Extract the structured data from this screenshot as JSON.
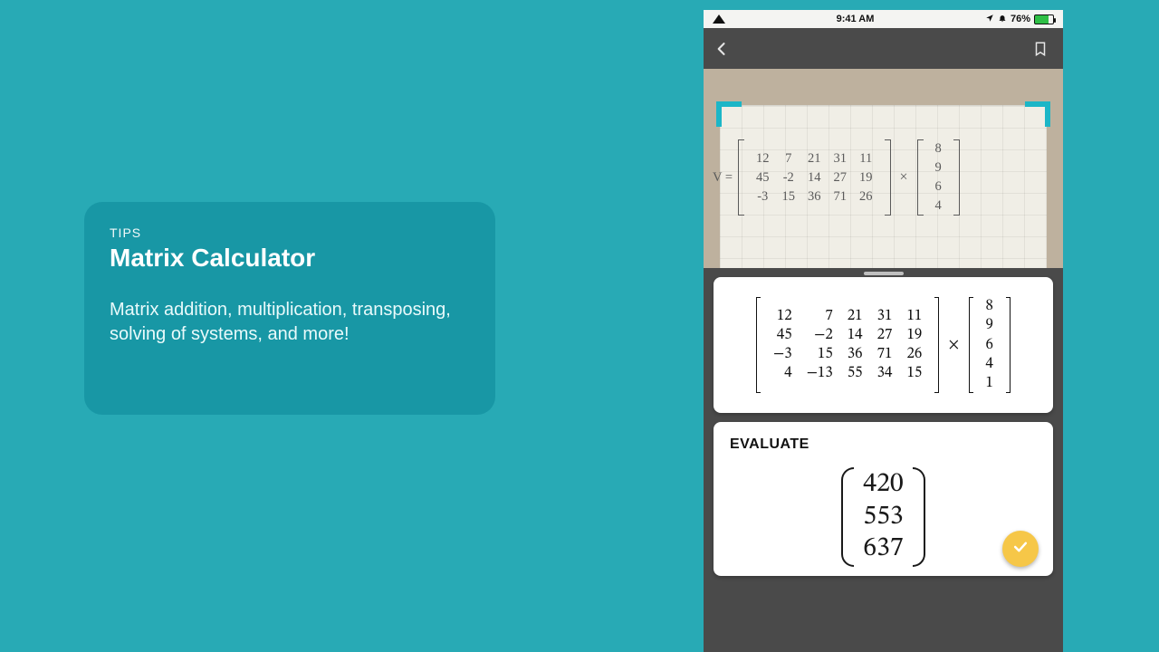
{
  "promo": {
    "eyebrow": "TIPS",
    "title": "Matrix Calculator",
    "desc": "Matrix addition, multiplication, transposing, solving of systems, and more!"
  },
  "statusbar": {
    "time": "9:41 AM",
    "battery_pct": "76%"
  },
  "handwritten": {
    "var_label": "V =",
    "matrix_a": [
      [
        "12",
        "7",
        "21",
        "31",
        "11"
      ],
      [
        "45",
        "-2",
        "14",
        "27",
        "19"
      ],
      [
        "-3",
        "15",
        "36",
        "71",
        "26"
      ]
    ],
    "operator": "×",
    "vector_b": [
      "8",
      "9",
      "6",
      "4"
    ]
  },
  "recognized": {
    "matrix_a": [
      [
        "12",
        "7",
        "21",
        "31",
        "11"
      ],
      [
        "45",
        "−2",
        "14",
        "27",
        "19"
      ],
      [
        "−3",
        "15",
        "36",
        "71",
        "26"
      ],
      [
        "4",
        "−13",
        "55",
        "34",
        "15"
      ]
    ],
    "operator": "×",
    "vector_b": [
      "8",
      "9",
      "6",
      "4",
      "1"
    ]
  },
  "evaluate": {
    "label": "EVALUATE",
    "result": [
      "420",
      "553",
      "637"
    ]
  }
}
